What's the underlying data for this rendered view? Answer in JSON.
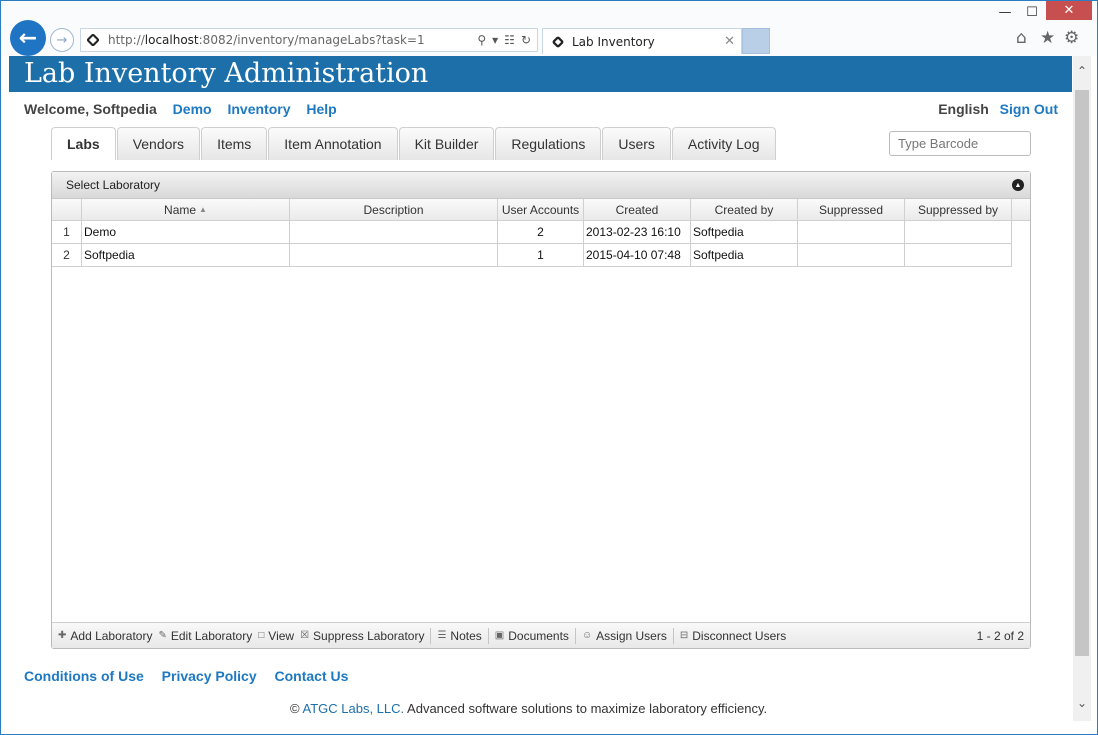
{
  "browser": {
    "url_prefix": "http://",
    "url_host": "localhost",
    "url_path": ":8082/inventory/manageLabs?task=1",
    "tab_title": "Lab Inventory",
    "min_label": "—",
    "max_label": "☐",
    "close_label": "✕",
    "back_icon": "arrow-left-icon",
    "forward_icon": "arrow-right-icon"
  },
  "app": {
    "title": "Lab Inventory Administration"
  },
  "topnav": {
    "welcome": "Welcome, Softpedia",
    "links": [
      "Demo",
      "Inventory",
      "Help"
    ],
    "language": "English",
    "signout": "Sign Out"
  },
  "tabs": [
    "Labs",
    "Vendors",
    "Items",
    "Item Annotation",
    "Kit Builder",
    "Regulations",
    "Users",
    "Activity Log"
  ],
  "barcode": {
    "placeholder": "Type Barcode"
  },
  "grid": {
    "caption": "Select Laboratory",
    "columns": [
      "Name",
      "Description",
      "User Accounts",
      "Created",
      "Created by",
      "Suppressed",
      "Suppressed by"
    ],
    "rows": [
      {
        "num": "1",
        "name": "Demo",
        "description": "",
        "accounts": "2",
        "created": "2013-02-23 16:10",
        "created_by": "Softpedia",
        "suppressed": "",
        "suppressed_by": ""
      },
      {
        "num": "2",
        "name": "Softpedia",
        "description": "",
        "accounts": "1",
        "created": "2015-04-10 07:48",
        "created_by": "Softpedia",
        "suppressed": "",
        "suppressed_by": ""
      }
    ],
    "toolbar": {
      "add": "Add Laboratory",
      "edit": "Edit Laboratory",
      "view": "View",
      "suppress": "Suppress Laboratory",
      "notes": "Notes",
      "documents": "Documents",
      "assign": "Assign Users",
      "disconnect": "Disconnect Users"
    },
    "pager": "1 - 2 of 2"
  },
  "footer": {
    "links": [
      "Conditions of Use",
      "Privacy Policy",
      "Contact Us"
    ],
    "copyright_symbol": "©",
    "company": "ATGC Labs, LLC.",
    "tagline": "Advanced software solutions to maximize laboratory efficiency."
  }
}
